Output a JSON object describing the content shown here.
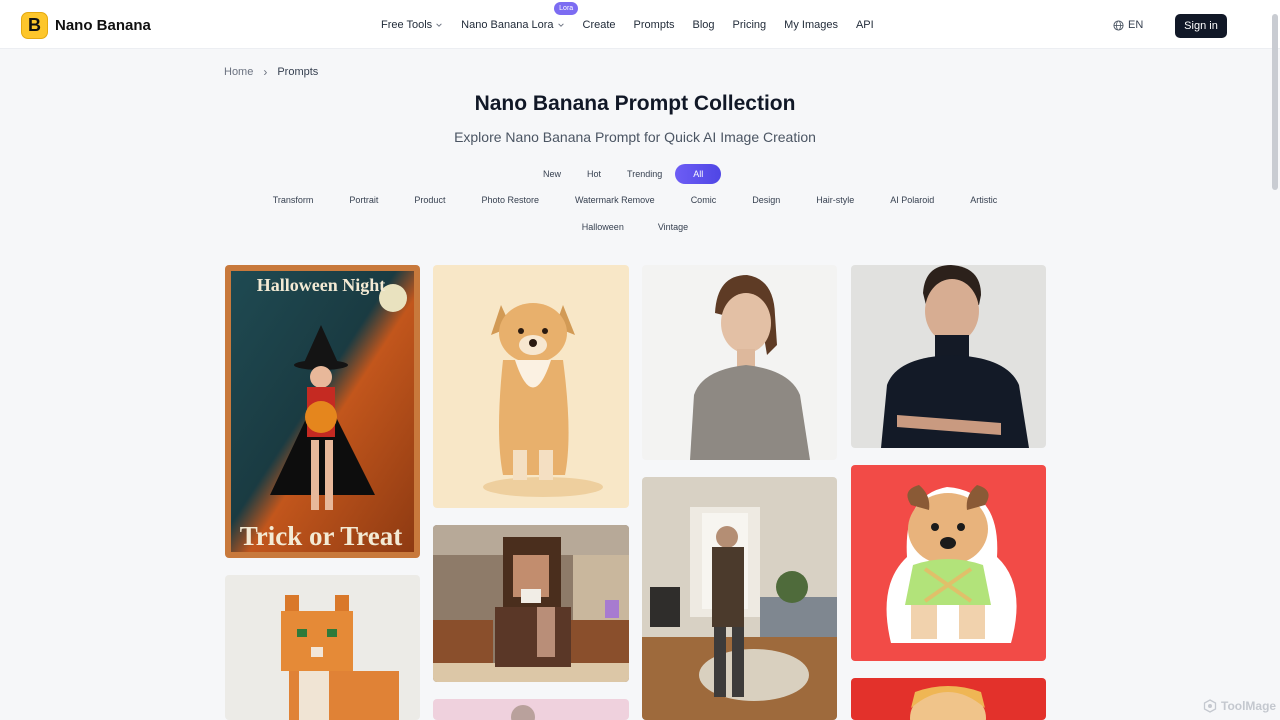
{
  "header": {
    "logo_letter": "B",
    "brand": "Nano Banana",
    "nav": [
      {
        "label": "Free Tools",
        "dropdown": true
      },
      {
        "label": "Nano Banana Lora",
        "dropdown": true,
        "badge": "Lora"
      },
      {
        "label": "Create"
      },
      {
        "label": "Prompts"
      },
      {
        "label": "Blog"
      },
      {
        "label": "Pricing"
      },
      {
        "label": "My Images"
      },
      {
        "label": "API"
      }
    ],
    "language": "EN",
    "signin": "Sign in"
  },
  "breadcrumb": {
    "home": "Home",
    "separator": "›",
    "current": "Prompts"
  },
  "page": {
    "title": "Nano Banana Prompt Collection",
    "subtitle": "Explore Nano Banana Prompt for Quick AI Image Creation"
  },
  "sort_tabs": [
    "New",
    "Hot",
    "Trending",
    "All"
  ],
  "sort_active": "All",
  "categories_row1": [
    "Transform",
    "Portrait",
    "Product",
    "Photo Restore",
    "Watermark Remove",
    "Comic",
    "Design",
    "Hair-style",
    "AI Polaroid",
    "Artistic"
  ],
  "categories_row2": [
    "Halloween",
    "Vintage"
  ],
  "gallery": {
    "halloween_title": "Halloween Night",
    "halloween_footer": "Trick or Treat"
  },
  "watermark": "ToolMage",
  "colors": {
    "accent": "#5b4ff0",
    "brand_yellow": "#fdc62b",
    "dark_button": "#111827"
  }
}
